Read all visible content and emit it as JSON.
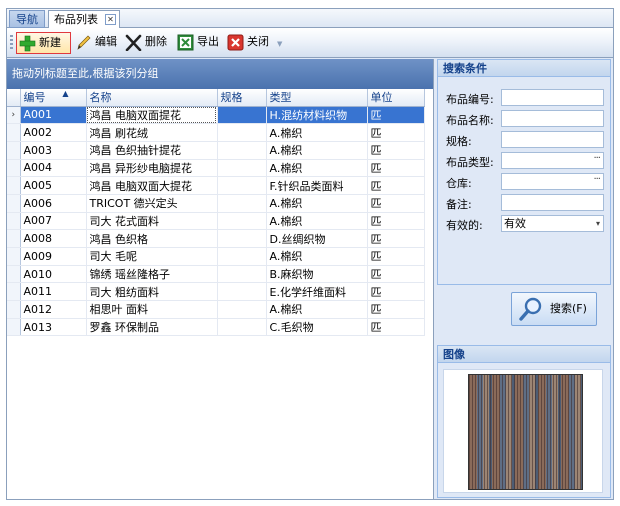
{
  "tabs": [
    {
      "label": "导航"
    },
    {
      "label": "布品列表"
    }
  ],
  "toolbar": {
    "new_label": "新建",
    "edit_label": "编辑",
    "delete_label": "删除",
    "export_label": "导出",
    "close_label": "关闭"
  },
  "grid": {
    "group_hint": "拖动列标题至此,根据该列分组",
    "columns": [
      "编号",
      "名称",
      "规格",
      "类型",
      "单位"
    ],
    "rows": [
      {
        "code": "A001",
        "name": "鸿昌 电脑双面提花",
        "spec": "",
        "type": "H.混纺材料织物",
        "unit": "匹"
      },
      {
        "code": "A002",
        "name": "鸿昌 刷花绒",
        "spec": "",
        "type": "A.棉织",
        "unit": "匹"
      },
      {
        "code": "A003",
        "name": "鸿昌 色织抽针提花",
        "spec": "",
        "type": "A.棉织",
        "unit": "匹"
      },
      {
        "code": "A004",
        "name": "鸿昌 异形纱电脑提花",
        "spec": "",
        "type": "A.棉织",
        "unit": "匹"
      },
      {
        "code": "A005",
        "name": "鸿昌 电脑双面大提花",
        "spec": "",
        "type": "F.针织品类面料",
        "unit": "匹"
      },
      {
        "code": "A006",
        "name": "TRICOT 德兴定头",
        "spec": "",
        "type": "A.棉织",
        "unit": "匹"
      },
      {
        "code": "A007",
        "name": "司大 花式面料",
        "spec": "",
        "type": "A.棉织",
        "unit": "匹"
      },
      {
        "code": "A008",
        "name": "鸿昌 色织格",
        "spec": "",
        "type": "D.丝绸织物",
        "unit": "匹"
      },
      {
        "code": "A009",
        "name": "司大 毛呢",
        "spec": "",
        "type": "A.棉织",
        "unit": "匹"
      },
      {
        "code": "A010",
        "name": "锦绣 瑶丝隆格子",
        "spec": "",
        "type": "B.麻织物",
        "unit": "匹"
      },
      {
        "code": "A011",
        "name": "司大 粗纺面料",
        "spec": "",
        "type": "E.化学纤维面料",
        "unit": "匹"
      },
      {
        "code": "A012",
        "name": "相思叶 面料",
        "spec": "",
        "type": "A.棉织",
        "unit": "匹"
      },
      {
        "code": "A013",
        "name": "罗鑫 环保制品",
        "spec": "",
        "type": "C.毛织物",
        "unit": "匹"
      }
    ]
  },
  "search": {
    "title": "搜索条件",
    "fields": [
      {
        "label": "布品编号:",
        "value": ""
      },
      {
        "label": "布品名称:",
        "value": ""
      },
      {
        "label": "规格:",
        "value": ""
      },
      {
        "label": "布品类型:",
        "value": ""
      },
      {
        "label": "仓库:",
        "value": ""
      },
      {
        "label": "备注:",
        "value": ""
      },
      {
        "label": "有效的:",
        "value": "有效"
      }
    ],
    "button_label": "搜索(F)"
  },
  "image_panel": {
    "title": "图像"
  },
  "colors": {
    "selection": "#3874d1",
    "header_bar": "#4a72ae",
    "panel_bg": "#dfe8f6"
  }
}
